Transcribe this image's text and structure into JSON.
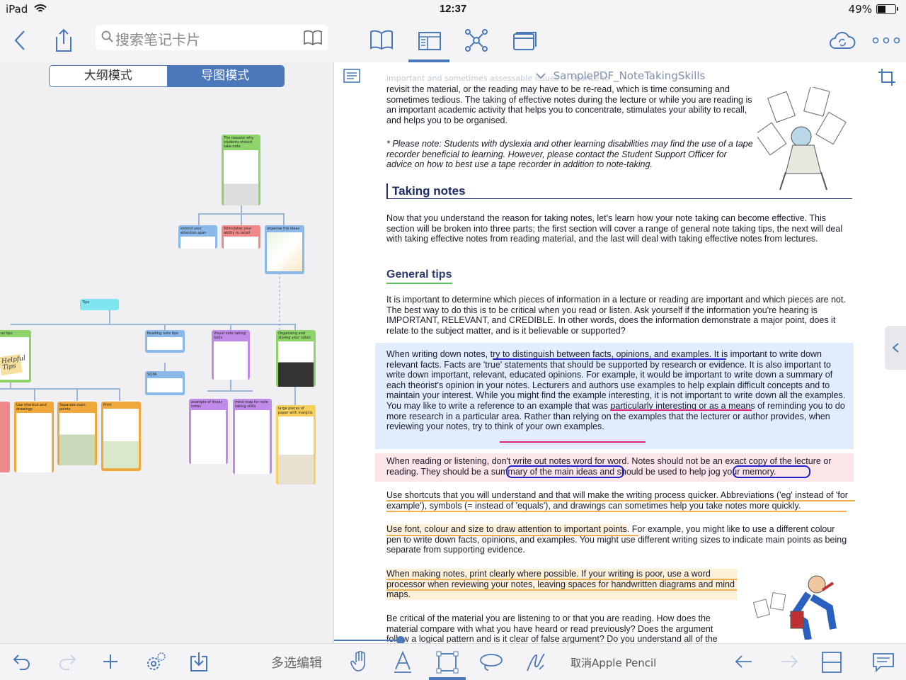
{
  "status": {
    "device": "iPad",
    "time": "12:37",
    "battery": "49%",
    "battery_level": 0.49
  },
  "toolbar": {
    "search_placeholder": "搜索笔记卡片"
  },
  "mode_switch": {
    "outline": "大纲模式",
    "mindmap": "导图模式",
    "active": "mindmap"
  },
  "mindmap": {
    "cards": [
      {
        "title": "The reasons why students should take note",
        "color": "#8fd46a"
      },
      {
        "title": "extend your attention span",
        "color": "#8ab8e8"
      },
      {
        "title": "Stimulates your ability to recall",
        "color": "#f08a8a"
      },
      {
        "title": "organise the ideas",
        "color": "#8ab8e8"
      },
      {
        "title": "Tips",
        "color": "#7fe6f0"
      },
      {
        "title": "Reading note tips",
        "color": "#8ab8e8"
      },
      {
        "title": "Visual note taking tools",
        "color": "#c08ae8"
      },
      {
        "title": "Organising and storing your notes",
        "color": "#8fd46a"
      },
      {
        "title": "SQ3R",
        "color": "#8ab8e8"
      },
      {
        "title": "example of linear notes",
        "color": "#c08ae8"
      },
      {
        "title": "mind map for note taking skills",
        "color": "#c08ae8"
      },
      {
        "title": "large pieces of paper with margins",
        "color": "#f5d05a"
      },
      {
        "title": "Use shortcut and drawings",
        "color": "#f0a83a"
      },
      {
        "title": "Separate main points",
        "color": "#f0a83a"
      },
      {
        "title": "Print",
        "color": "#f0a83a"
      },
      {
        "title": "eneral tips",
        "color": "#8fd46a"
      }
    ],
    "sticker": "Helpful Tips"
  },
  "document": {
    "title": "SamplePDF_NoteTakingSkills",
    "faded_header": "important and sometimes assessable issues ... chance to",
    "paragraphs": {
      "intro": "revisit the material, or the reading may have to be re-read, which is time consuming and sometimes tedious.  The taking of effective notes during the lecture or while you are reading is an important academic activity that helps you to concentrate, stimulates your ability to recall, and helps you to be organised.",
      "note": "* Please note: Students with dyslexia and other learning disabilities may find the use of a tape recorder beneficial to learning.  However, please contact the Student Support Officer for advice on how to best use a tape recorder in addition to note-taking.",
      "heading": "Taking notes",
      "p1": "Now that you understand the reason for taking notes, let's learn how your note taking can become effective.  This section will be broken into three parts; the first section will cover a range of general note taking tips, the next will deal with taking effective notes from reading material, and the last will deal with taking effective notes from lectures.",
      "subheading": "General tips",
      "p2": "It is important to determine which pieces of information in a lecture or reading are important and which pieces are not.  The best way to do this is to be critical when you read or listen.  Ask yourself if the information you're hearing is IMPORTANT, RELEVANT, and CREDIBLE.  In other words, does the information demonstrate a major point, does it relate to the subject matter, and is it believable or supported?",
      "p3": "When writing down notes, try to distinguish between facts, opinions, and examples.  It is important to write down relevant facts.  Facts are 'true' statements that should be supported by research or evidence.  It is also important to write down important, relevant, educated opinions.  For example, it would be important to write down a summary of each theorist's opinion in your notes.  Lecturers and authors use examples to help explain difficult concepts and to maintain your interest.  While you might find the example interesting, it is not important to write down all the examples.  You may like to write a reference to an example that was particularly interesting or as a means of reminding you to do more research in a particular area.  Rather than relying on the examples that the lecturer or author provides, when reviewing your notes, try to think of your own examples.",
      "p4": "When reading or listening, don't write out notes word for word.  Notes should not be an exact copy of the lecture or reading.  They should be a summary of the main ideas and should be used to help jog your memory.",
      "p5": "Use shortcuts that you will understand and that will make the writing process quicker.  Abbreviations ('eg' instead of 'for example'), symbols (= instead of 'equals'), and drawings can sometimes help you take notes more quickly.",
      "p6a": "Use font, colour and size to draw attention to important points",
      "p6b": ".  For example, you might like to use a different colour pen to write down facts, opinions, and examples.  You might use different writing sizes to indicate main points as being separate from supporting evidence.",
      "p7": "When making notes, print clearly where possible.  If your writing is poor, use a word processor when reviewing your notes, leaving spaces for handwritten diagrams and mind maps.",
      "p8": "Be critical of the material you are listening to or that you are reading.  How does the material compare with what you have heard or read previously?  Does the argument follow a logical pattern and is it clear of false argument?  Do you understand all of the"
    }
  },
  "bottombar": {
    "multi_edit": "多选编辑",
    "cancel_pencil": "取消Apple Pencil"
  },
  "colors": {
    "accent": "#4a78b8",
    "highlight_blue": "#e1edfa",
    "highlight_pink": "#fce5e8",
    "highlight_orange": "#fdf0d8",
    "heading_green": "#5fbf5a"
  }
}
